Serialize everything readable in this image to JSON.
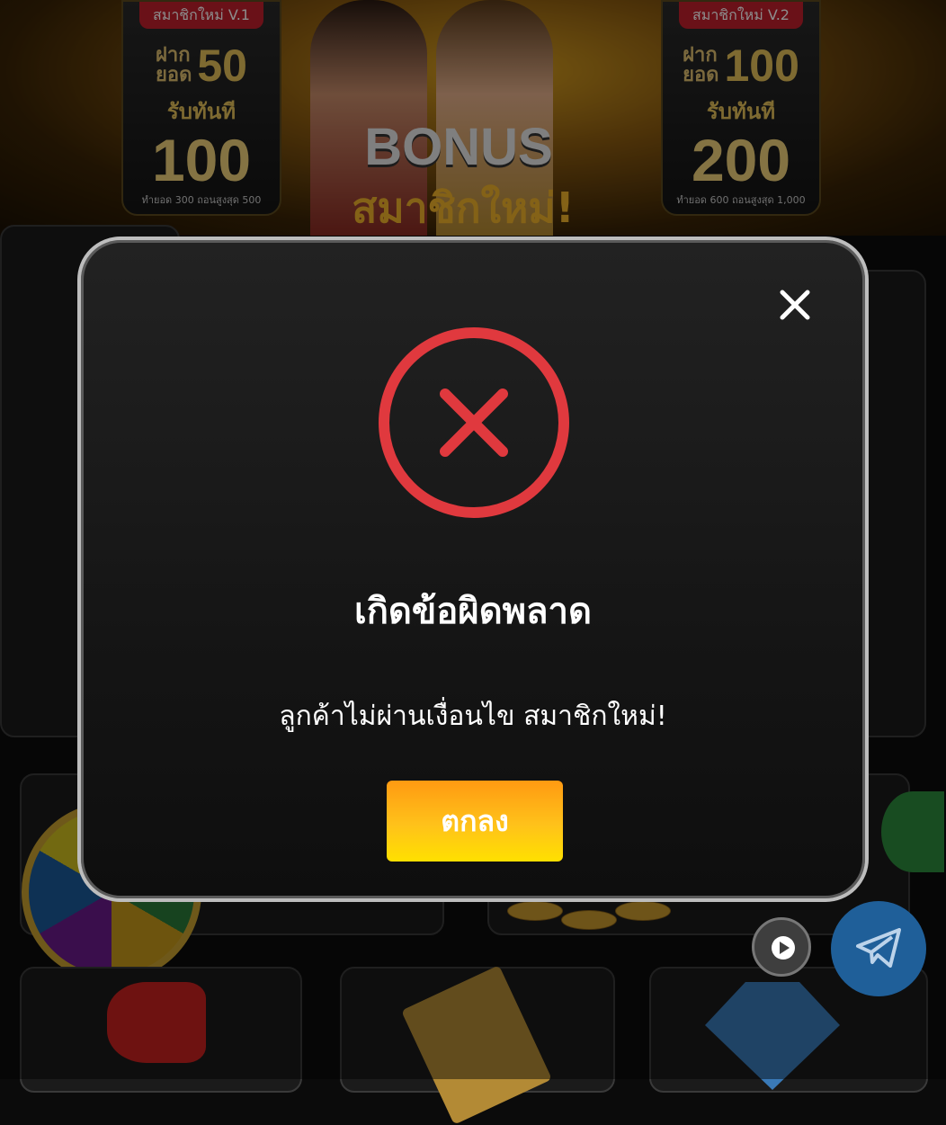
{
  "banner": {
    "promo_left": {
      "tag": "สมาชิกใหม่ V.1",
      "deposit_label_1": "ฝาก",
      "deposit_label_2": "ยอด",
      "deposit_amount": "50",
      "receive_label": "รับทันที",
      "receive_amount": "100",
      "note": "ทำยอด 300 ถอนสูงสุด 500"
    },
    "promo_right": {
      "tag": "สมาชิกใหม่ V.2",
      "deposit_label_1": "ฝาก",
      "deposit_label_2": "ยอด",
      "deposit_amount": "100",
      "receive_label": "รับทันที",
      "receive_amount": "200",
      "note": "ทำยอด 600 ถอนสูงสุด 1,000"
    },
    "title": "BONUS",
    "subtitle": "สมาชิกใหม่!"
  },
  "modal": {
    "icon": "error-x-circle-icon",
    "icon_color": "#e0393e",
    "title": "เกิดข้อผิดพลาด",
    "message": "ลูกค้าไม่ผ่านเงื่อนไข สมาชิกใหม่!",
    "confirm_label": "ตกลง",
    "close_icon": "close-icon",
    "button_gradient": [
      "#ff9a12",
      "#ffe000"
    ]
  },
  "floating": {
    "play_icon": "play-icon",
    "telegram_icon": "telegram-icon"
  }
}
